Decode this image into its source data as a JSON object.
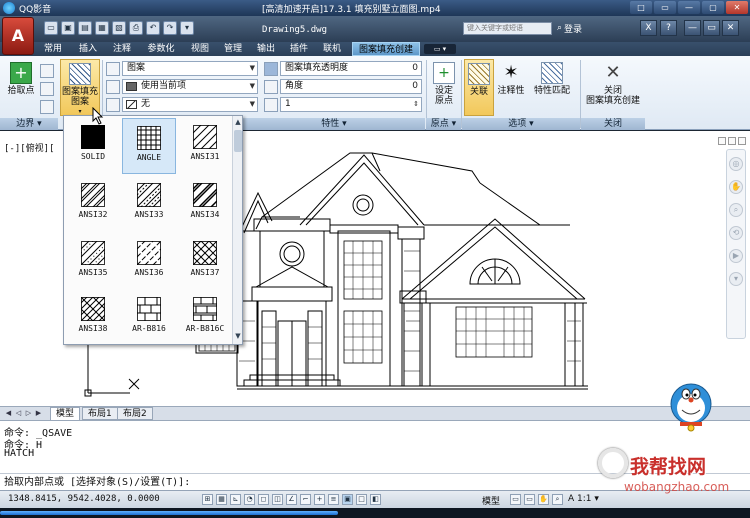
{
  "player": {
    "title": "QQ影音",
    "window_controls": [
      "□",
      "▭",
      "—",
      "▢",
      "✕"
    ]
  },
  "cad": {
    "app_button": "A",
    "doc_title": "[高清加速开启]17.3.1 填充别墅立面图.mp4",
    "doc_title_center": "Drawing5.dwg",
    "search_placeholder": "键入关键字或短语",
    "login": "登录",
    "quick_access": [
      "▭",
      "▣",
      "▤",
      "▦",
      "▧",
      "⎙",
      "↶",
      "↷",
      "▾"
    ]
  },
  "tabs": [
    "常用",
    "插入",
    "注释",
    "参数化",
    "视图",
    "管理",
    "输出",
    "插件",
    "联机",
    "图案填充创建"
  ],
  "tabs_extra": "▭ ▾",
  "ribbon": {
    "pick_points": "拾取点",
    "hatch_pattern_label_1": "图案填充",
    "hatch_pattern_label_2": "图案",
    "field_pattern": "图案",
    "field_color": "使用当前项",
    "field_bg": "无",
    "field_transparency": "图案填充透明度",
    "field_transparency_value": "0",
    "field_angle": "角度",
    "field_angle_value": "0",
    "field_scale_value": "1",
    "set_origin_1": "设定",
    "set_origin_2": "原点",
    "associative": "关联",
    "annotative": "注释性",
    "match_properties": "特性匹配",
    "close_1": "关闭",
    "close_2": "图案填充创建",
    "panel_boundary": "边界 ▾",
    "panel_properties": "特性 ▾",
    "panel_origin": "原点 ▾",
    "panel_options": "选项 ▾",
    "panel_close": "关闭"
  },
  "view_label": "[-][俯视][",
  "gallery": {
    "patterns": [
      "SOLID",
      "ANGLE",
      "ANSI31",
      "ANSI32",
      "ANSI33",
      "ANSI34",
      "ANSI35",
      "ANSI36",
      "ANSI37",
      "ANSI38",
      "AR-B816",
      "AR-B816C"
    ],
    "selected": "ANGLE"
  },
  "layout_tabs": [
    "模型",
    "布局1",
    "布局2"
  ],
  "command": {
    "lines": [
      "命令: _QSAVE",
      "命令: H",
      "HATCH"
    ],
    "prompt": "拾取内部点或 [选择对象(S)/设置(T)]:"
  },
  "status": {
    "coords": "1348.8415,   9542.4028, 0.0000",
    "model": "模型",
    "scale": "A 1:1 ▾"
  },
  "progress": {
    "fraction": 0.45
  },
  "watermark": {
    "main": "我帮找网",
    "sub": "wobangzhao.com"
  }
}
